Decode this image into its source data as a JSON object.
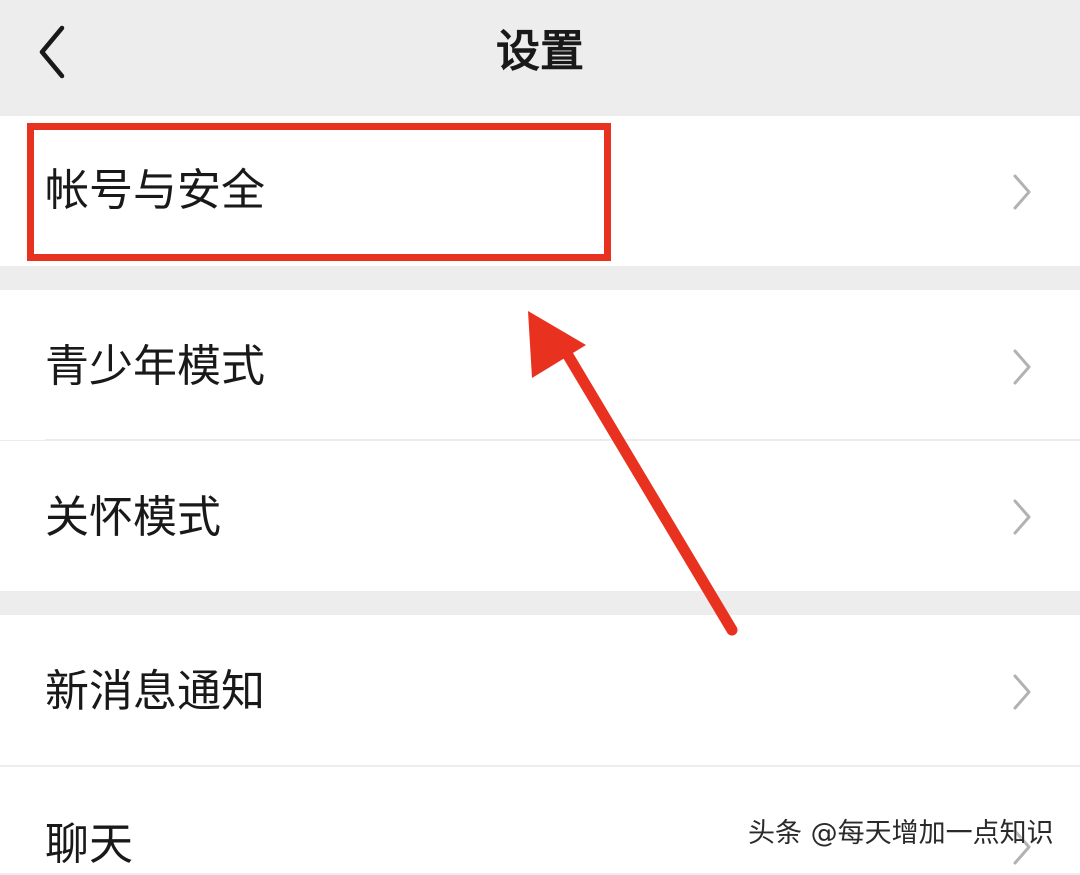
{
  "header": {
    "title": "设置",
    "back_icon": "chevron-left-icon"
  },
  "settings": {
    "items": [
      {
        "label": "帐号与安全",
        "icon": "chevron-right-icon",
        "highlighted": true
      },
      {
        "label": "青少年模式",
        "icon": "chevron-right-icon"
      },
      {
        "label": "关怀模式",
        "icon": "chevron-right-icon"
      },
      {
        "label": "新消息通知",
        "icon": "chevron-right-icon"
      },
      {
        "label": "聊天",
        "icon": "chevron-right-icon"
      }
    ]
  },
  "annotation": {
    "highlight_color": "#e8321f",
    "arrow_color": "#e8321f"
  },
  "watermark": {
    "text": "头条 @每天增加一点知识"
  },
  "colors": {
    "background": "#ededed",
    "row_background": "#ffffff",
    "text": "#191919",
    "chevron": "#b2b2b2"
  }
}
